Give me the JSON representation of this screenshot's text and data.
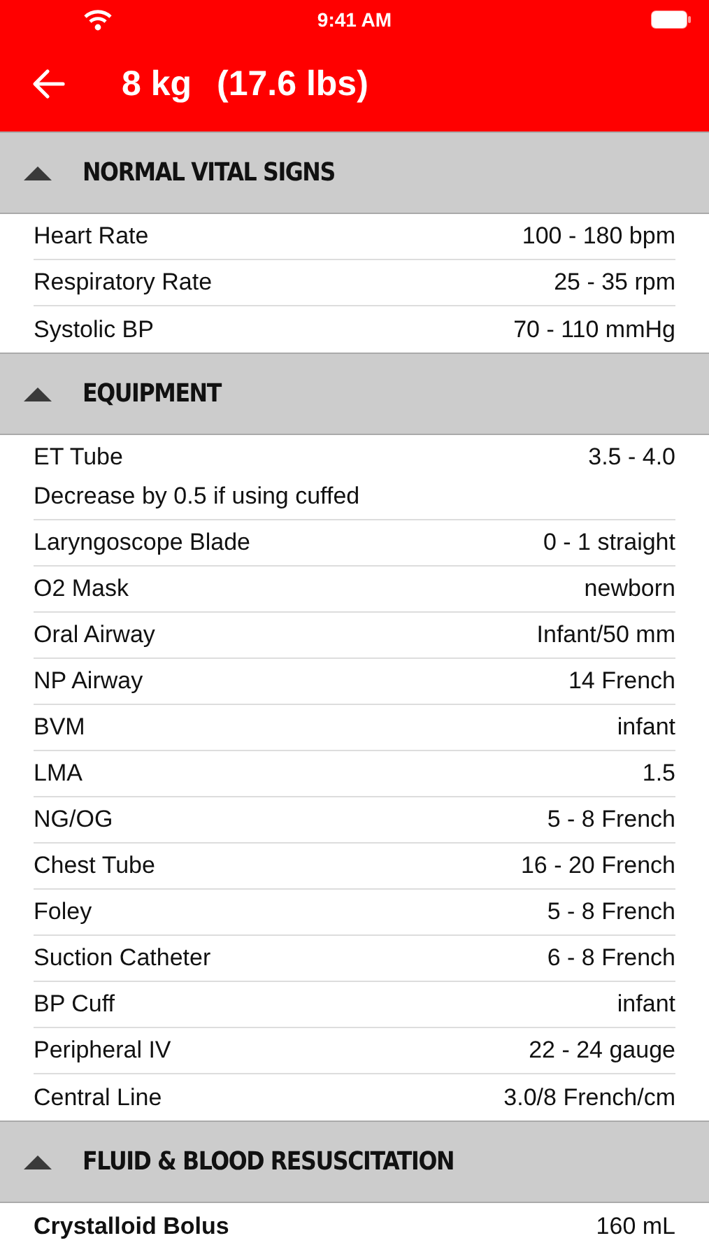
{
  "status_bar": {
    "time": "9:41 AM"
  },
  "header": {
    "title": "8 kg",
    "subtitle": "(17.6 lbs)"
  },
  "sections": [
    {
      "title": "NORMAL VITAL SIGNS",
      "expanded": true,
      "rows": [
        {
          "label": "Heart Rate",
          "value": "100 - 180 bpm",
          "bold": false
        },
        {
          "label": "Respiratory Rate",
          "value": "25 - 35 rpm",
          "bold": false
        },
        {
          "label": "Systolic BP",
          "value": "70 - 110 mmHg",
          "bold": false
        }
      ]
    },
    {
      "title": "EQUIPMENT",
      "expanded": true,
      "rows": [
        {
          "label": "ET Tube",
          "value": "3.5 - 4.0",
          "note": "Decrease by 0.5 if using cuffed",
          "bold": false
        },
        {
          "label": "Laryngoscope Blade",
          "value": "0 - 1 straight",
          "bold": false
        },
        {
          "label": "O2 Mask",
          "value": "newborn",
          "bold": false
        },
        {
          "label": "Oral Airway",
          "value": "Infant/50 mm",
          "bold": false
        },
        {
          "label": "NP Airway",
          "value": "14 French",
          "bold": false
        },
        {
          "label": "BVM",
          "value": "infant",
          "bold": false
        },
        {
          "label": "LMA",
          "value": "1.5",
          "bold": false
        },
        {
          "label": "NG/OG",
          "value": "5 - 8 French",
          "bold": false
        },
        {
          "label": "Chest Tube",
          "value": "16 - 20 French",
          "bold": false
        },
        {
          "label": "Foley",
          "value": "5 - 8 French",
          "bold": false
        },
        {
          "label": "Suction Catheter",
          "value": "6 - 8 French",
          "bold": false
        },
        {
          "label": "BP Cuff",
          "value": "infant",
          "bold": false
        },
        {
          "label": "Peripheral IV",
          "value": "22 - 24 gauge",
          "bold": false
        },
        {
          "label": "Central Line",
          "value": "3.0/8 French/cm",
          "bold": false
        }
      ]
    },
    {
      "title": "FLUID & BLOOD RESUSCITATION",
      "expanded": true,
      "rows": [
        {
          "label": "Crystalloid Bolus",
          "value": "160 mL",
          "bold": true
        }
      ]
    }
  ]
}
